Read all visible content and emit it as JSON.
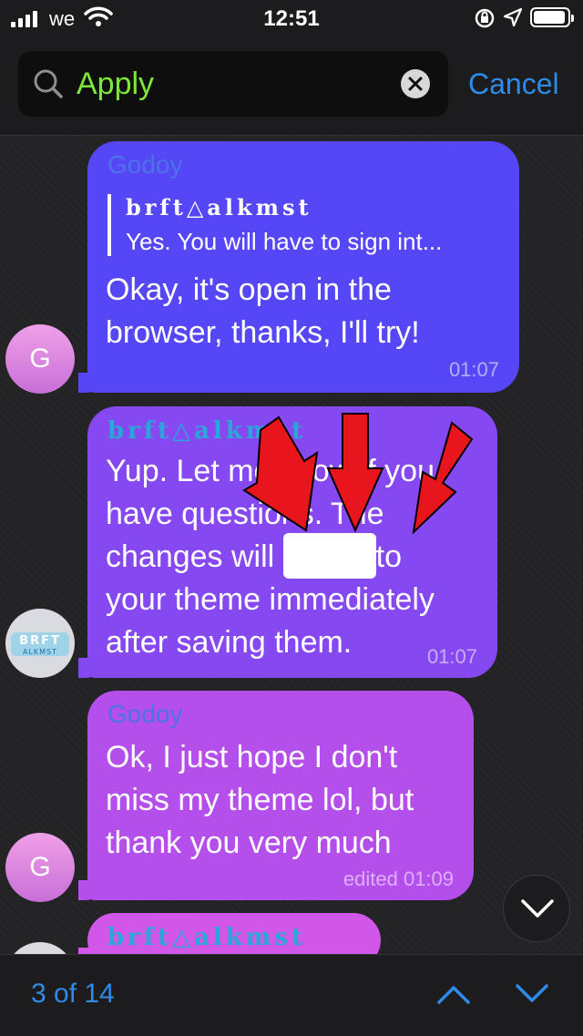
{
  "status_bar": {
    "carrier": "we",
    "time": "12:51"
  },
  "search": {
    "value": "Apply",
    "cancel_label": "Cancel"
  },
  "messages": [
    {
      "avatar_initial": "G",
      "sender": "Godoy",
      "reply": {
        "sender": "brft△alkmst",
        "text": "Yes. You will have to sign int..."
      },
      "lines": [
        "Okay, it's open in the",
        "browser, thanks, I'll try!"
      ],
      "time": "01:07"
    },
    {
      "sender": "brft△alkmst",
      "avatar_logo": "BRFT ALKMST",
      "lines": [
        "Yup. Let me know if you",
        "have questions. The",
        "changes will",
        "to",
        "your theme immediately",
        "after saving them."
      ],
      "time": "01:07"
    },
    {
      "avatar_initial": "G",
      "sender": "Godoy",
      "lines": [
        "Ok, I just hope I don't",
        "miss my theme lol, but",
        "thank you very much"
      ],
      "time": "edited 01:09"
    },
    {
      "sender": "brft△alkmst"
    }
  ],
  "search_results": {
    "count_label": "3 of 14"
  },
  "colors": {
    "accent": "#2f8ae8",
    "search_text": "#7ee83a",
    "arrow": "#e8161c"
  }
}
